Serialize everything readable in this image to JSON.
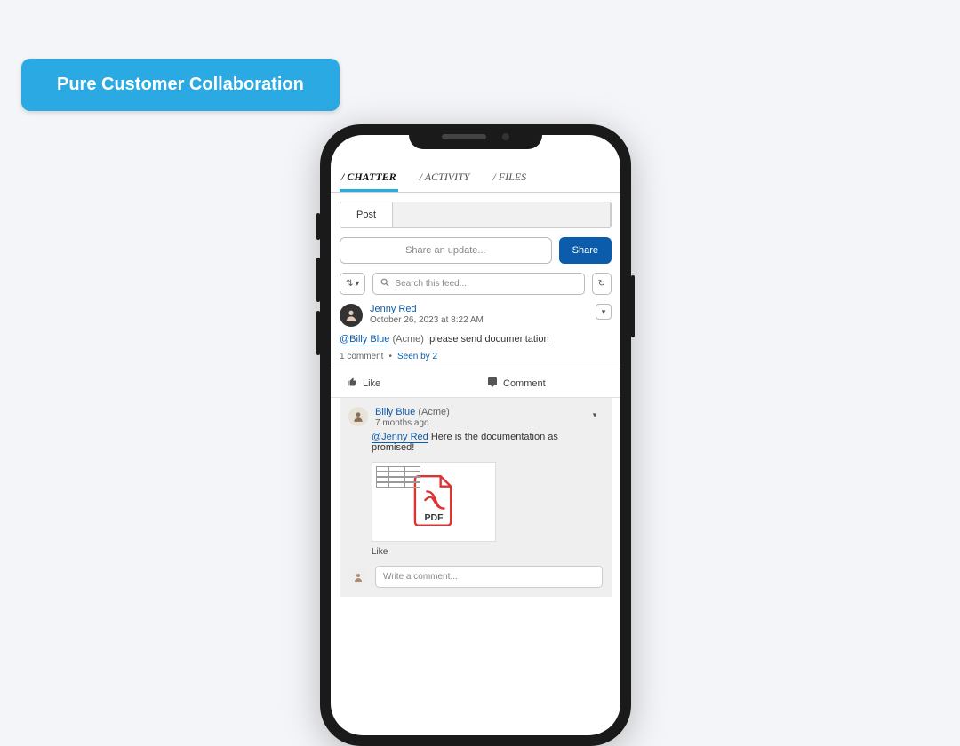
{
  "badge": "Pure Customer Collaboration",
  "tabs": {
    "chatter": "/ CHATTER",
    "activity": "/ ACTIVITY",
    "files": "/ FILES"
  },
  "postTab": "Post",
  "share": {
    "placeholder": "Share an update...",
    "button": "Share"
  },
  "search": {
    "placeholder": "Search this feed..."
  },
  "feed": {
    "author": "Jenny Red",
    "timestamp": "October 26, 2023 at 8:22 AM",
    "mention": "@Billy Blue",
    "mentionParen": "(Acme)",
    "body": "please send documentation",
    "commentsCount": "1 comment",
    "seen": "Seen by 2"
  },
  "actions": {
    "like": "Like",
    "comment": "Comment"
  },
  "reply": {
    "author": "Billy Blue",
    "authorParen": "(Acme)",
    "timestamp": "7 months ago",
    "mention": "@Jenny Red",
    "body": "Here is the documentation as promised!",
    "pdfLabel": "PDF",
    "like": "Like"
  },
  "commentBox": {
    "placeholder": "Write a comment..."
  }
}
